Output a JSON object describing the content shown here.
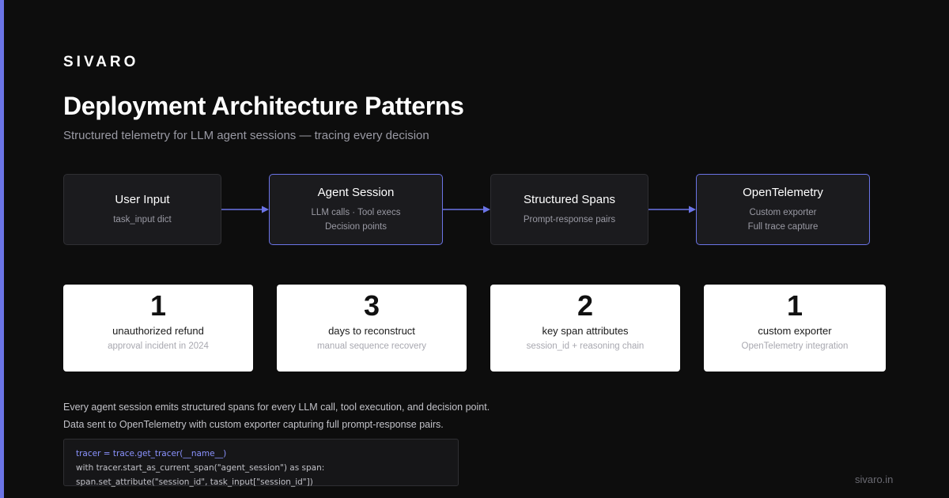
{
  "brand": "SIVARO",
  "title": "Deployment Architecture Patterns",
  "subtitle": "Structured telemetry for LLM agent sessions — tracing every decision",
  "flow": {
    "nodes": [
      {
        "title": "User Input",
        "lines": [
          "task_input dict"
        ],
        "highlighted": false
      },
      {
        "title": "Agent Session",
        "lines": [
          "LLM calls · Tool execs",
          "Decision points"
        ],
        "highlighted": true
      },
      {
        "title": "Structured Spans",
        "lines": [
          "Prompt-response pairs"
        ],
        "highlighted": false
      },
      {
        "title": "OpenTelemetry",
        "lines": [
          "Custom exporter",
          "Full trace capture"
        ],
        "highlighted": true
      }
    ]
  },
  "stats": [
    {
      "value": "1",
      "label": "unauthorized refund",
      "sub": "approval incident in 2024"
    },
    {
      "value": "3",
      "label": "days to reconstruct",
      "sub": "manual sequence recovery"
    },
    {
      "value": "2",
      "label": "key span attributes",
      "sub": "session_id + reasoning chain"
    },
    {
      "value": "1",
      "label": "custom exporter",
      "sub": "OpenTelemetry integration"
    }
  ],
  "body": {
    "line1": "Every agent session emits structured spans for every LLM call, tool execution, and decision point.",
    "line2": "Data sent to OpenTelemetry with custom exporter capturing full prompt-response pairs."
  },
  "code": {
    "line1": "tracer = trace.get_tracer(__name__)",
    "line2": "with tracer.start_as_current_span(\"agent_session\") as span:",
    "line3": "span.set_attribute(\"session_id\", task_input[\"session_id\"])"
  },
  "footer": {
    "url": "sivaro.in"
  },
  "colors": {
    "accent": "#6b74e6",
    "background": "#0d0d0d",
    "card": "#ffffff"
  }
}
